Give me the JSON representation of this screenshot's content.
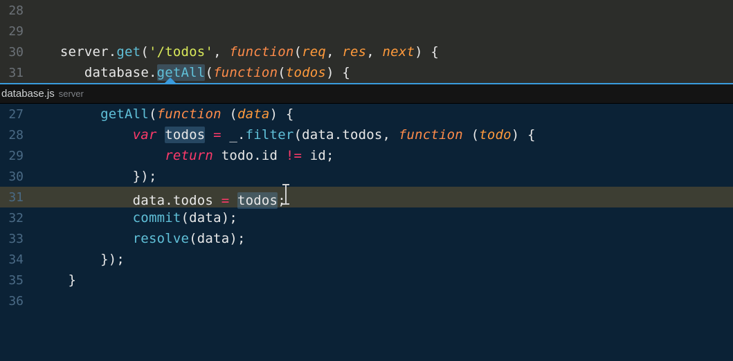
{
  "top_pane": {
    "lines": [
      {
        "num": "28",
        "tokens": []
      },
      {
        "num": "29",
        "tokens": []
      },
      {
        "num": "30",
        "tokens": [
          {
            "t": "   ",
            "c": "punct"
          },
          {
            "t": "server",
            "c": "ident"
          },
          {
            "t": ".",
            "c": "punct"
          },
          {
            "t": "get",
            "c": "method"
          },
          {
            "t": "(",
            "c": "punct"
          },
          {
            "t": "'/todos'",
            "c": "string"
          },
          {
            "t": ", ",
            "c": "punct"
          },
          {
            "t": "function",
            "c": "k-func"
          },
          {
            "t": "(",
            "c": "punct"
          },
          {
            "t": "req",
            "c": "param"
          },
          {
            "t": ", ",
            "c": "punct"
          },
          {
            "t": "res",
            "c": "param"
          },
          {
            "t": ", ",
            "c": "punct"
          },
          {
            "t": "next",
            "c": "param"
          },
          {
            "t": ") {",
            "c": "punct"
          }
        ]
      },
      {
        "num": "31",
        "tokens": [
          {
            "t": "      ",
            "c": "punct"
          },
          {
            "t": "database",
            "c": "ident"
          },
          {
            "t": ".",
            "c": "punct"
          },
          {
            "t": "getAll",
            "c": "method",
            "hl": true
          },
          {
            "t": "(",
            "c": "punct"
          },
          {
            "t": "function",
            "c": "k-func"
          },
          {
            "t": "(",
            "c": "punct"
          },
          {
            "t": "todos",
            "c": "param"
          },
          {
            "t": ") {",
            "c": "punct"
          }
        ]
      }
    ]
  },
  "peek": {
    "filename": "database.js",
    "scope": "server"
  },
  "bottom_pane": {
    "highlighted_line": "31",
    "lines": [
      {
        "num": "27",
        "tokens": [
          {
            "t": "        ",
            "c": "punct"
          },
          {
            "t": "getAll",
            "c": "method"
          },
          {
            "t": "(",
            "c": "punct"
          },
          {
            "t": "function",
            "c": "k-func"
          },
          {
            "t": " (",
            "c": "punct"
          },
          {
            "t": "data",
            "c": "param"
          },
          {
            "t": ") {",
            "c": "punct"
          }
        ]
      },
      {
        "num": "28",
        "tokens": [
          {
            "t": "            ",
            "c": "punct"
          },
          {
            "t": "var",
            "c": "k-var"
          },
          {
            "t": " ",
            "c": "punct"
          },
          {
            "t": "todos",
            "c": "ident",
            "hl": true
          },
          {
            "t": " ",
            "c": "punct"
          },
          {
            "t": "=",
            "c": "op"
          },
          {
            "t": " _",
            "c": "ident"
          },
          {
            "t": ".",
            "c": "punct"
          },
          {
            "t": "filter",
            "c": "method"
          },
          {
            "t": "(data",
            "c": "ident"
          },
          {
            "t": ".",
            "c": "punct"
          },
          {
            "t": "todos",
            "c": "prop"
          },
          {
            "t": ", ",
            "c": "punct"
          },
          {
            "t": "function",
            "c": "k-func"
          },
          {
            "t": " (",
            "c": "punct"
          },
          {
            "t": "todo",
            "c": "param"
          },
          {
            "t": ") {",
            "c": "punct"
          }
        ]
      },
      {
        "num": "29",
        "tokens": [
          {
            "t": "                ",
            "c": "punct"
          },
          {
            "t": "return",
            "c": "k-return"
          },
          {
            "t": " todo",
            "c": "ident"
          },
          {
            "t": ".",
            "c": "punct"
          },
          {
            "t": "id ",
            "c": "prop"
          },
          {
            "t": "!=",
            "c": "op"
          },
          {
            "t": " id;",
            "c": "ident"
          }
        ]
      },
      {
        "num": "30",
        "tokens": [
          {
            "t": "            });",
            "c": "punct"
          }
        ]
      },
      {
        "num": "31",
        "tokens": [
          {
            "t": "            data",
            "c": "ident"
          },
          {
            "t": ".",
            "c": "punct"
          },
          {
            "t": "todos ",
            "c": "prop"
          },
          {
            "t": "=",
            "c": "op"
          },
          {
            "t": " ",
            "c": "punct"
          },
          {
            "t": "todos",
            "c": "ident",
            "hl": true
          },
          {
            "t": ";",
            "c": "punct"
          },
          {
            "cursor": true
          }
        ]
      },
      {
        "num": "32",
        "tokens": [
          {
            "t": "            commit",
            "c": "method"
          },
          {
            "t": "(data);",
            "c": "ident"
          }
        ]
      },
      {
        "num": "33",
        "tokens": [
          {
            "t": "            resolve",
            "c": "method"
          },
          {
            "t": "(data);",
            "c": "ident"
          }
        ]
      },
      {
        "num": "34",
        "tokens": [
          {
            "t": "        });",
            "c": "punct"
          }
        ]
      },
      {
        "num": "35",
        "tokens": [
          {
            "t": "    }",
            "c": "punct"
          }
        ]
      },
      {
        "num": "36",
        "tokens": []
      }
    ]
  }
}
